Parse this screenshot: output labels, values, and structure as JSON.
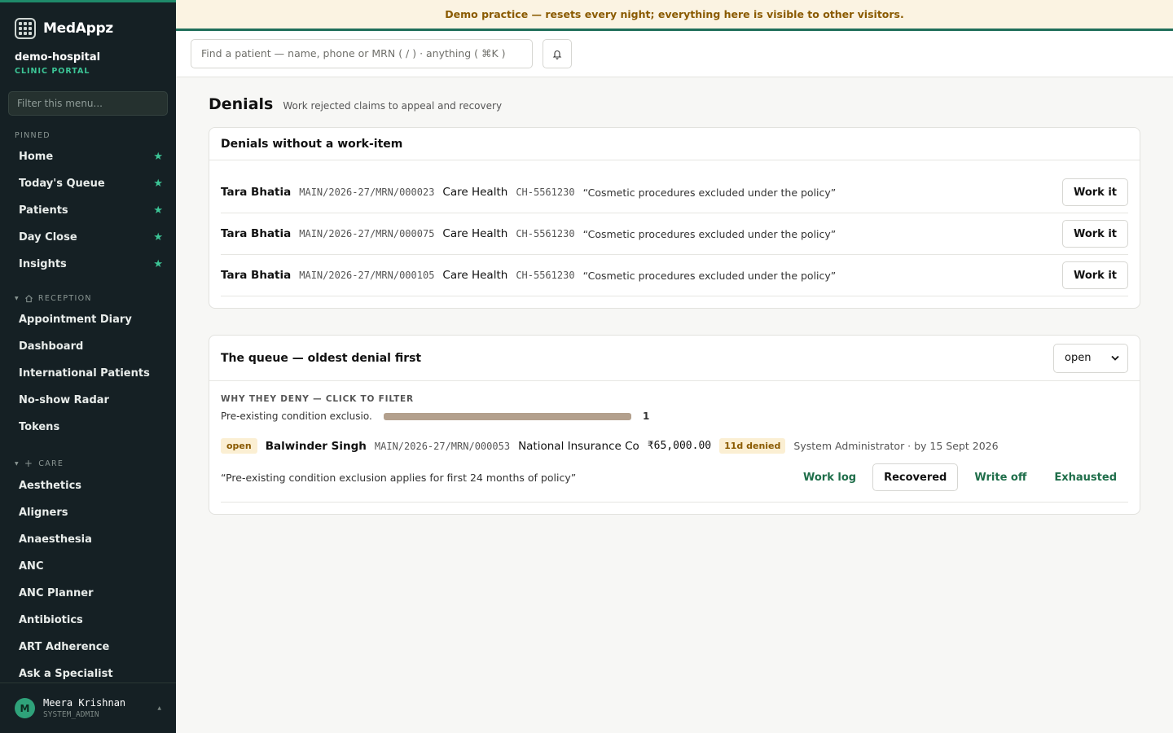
{
  "app": {
    "name": "MedAppz",
    "org_name": "demo-hospital",
    "org_sub": "CLINIC PORTAL"
  },
  "sidebar": {
    "filter_placeholder": "Filter this menu...",
    "pinned_label": "PINNED",
    "pinned": [
      {
        "label": "Home"
      },
      {
        "label": "Today's Queue"
      },
      {
        "label": "Patients"
      },
      {
        "label": "Day Close"
      },
      {
        "label": "Insights"
      }
    ],
    "reception_label": "RECEPTION",
    "reception": [
      {
        "label": "Appointment Diary"
      },
      {
        "label": "Dashboard"
      },
      {
        "label": "International Patients"
      },
      {
        "label": "No-show Radar"
      },
      {
        "label": "Tokens"
      }
    ],
    "care_label": "CARE",
    "care": [
      {
        "label": "Aesthetics"
      },
      {
        "label": "Aligners"
      },
      {
        "label": "Anaesthesia"
      },
      {
        "label": "ANC"
      },
      {
        "label": "ANC Planner"
      },
      {
        "label": "Antibiotics"
      },
      {
        "label": "ART Adherence"
      },
      {
        "label": "Ask a Specialist"
      }
    ],
    "user": {
      "initial": "M",
      "name": "Meera Krishnan",
      "role": "SYSTEM_ADMIN"
    }
  },
  "banner": "Demo practice — resets every night; everything here is visible to other visitors.",
  "search": {
    "placeholder": "Find a patient — name, phone or MRN ( / ) · anything ( ⌘K )"
  },
  "page": {
    "title": "Denials",
    "subtitle": "Work rejected claims to appeal and recovery"
  },
  "unassigned": {
    "title": "Denials without a work-item",
    "action_label": "Work it",
    "rows": [
      {
        "name": "Tara Bhatia",
        "mrn": "MAIN/2026-27/MRN/000023",
        "payer": "Care Health",
        "claim": "CH-5561230",
        "reason": "“Cosmetic procedures excluded under the policy”"
      },
      {
        "name": "Tara Bhatia",
        "mrn": "MAIN/2026-27/MRN/000075",
        "payer": "Care Health",
        "claim": "CH-5561230",
        "reason": "“Cosmetic procedures excluded under the policy”"
      },
      {
        "name": "Tara Bhatia",
        "mrn": "MAIN/2026-27/MRN/000105",
        "payer": "Care Health",
        "claim": "CH-5561230",
        "reason": "“Cosmetic procedures excluded under the policy”"
      }
    ]
  },
  "queue": {
    "title": "The queue — oldest denial first",
    "status_filter": "open",
    "why_label": "WHY THEY DENY — CLICK TO FILTER",
    "reasons": [
      {
        "label": "Pre-existing condition exclusio...",
        "count": "1",
        "share": 1.0
      }
    ],
    "items": [
      {
        "status": "open",
        "name": "Balwinder Singh",
        "mrn": "MAIN/2026-27/MRN/000053",
        "payer": "National Insurance Co",
        "amount": "₹65,000.00",
        "age": "11d denied",
        "meta": "System Administrator · by 15 Sept 2026",
        "reason": "“Pre-existing condition exclusion applies for first 24 months of policy”",
        "actions": {
          "work_log": "Work log",
          "recovered": "Recovered",
          "write_off": "Write off",
          "exhausted": "Exhausted"
        }
      }
    ]
  }
}
